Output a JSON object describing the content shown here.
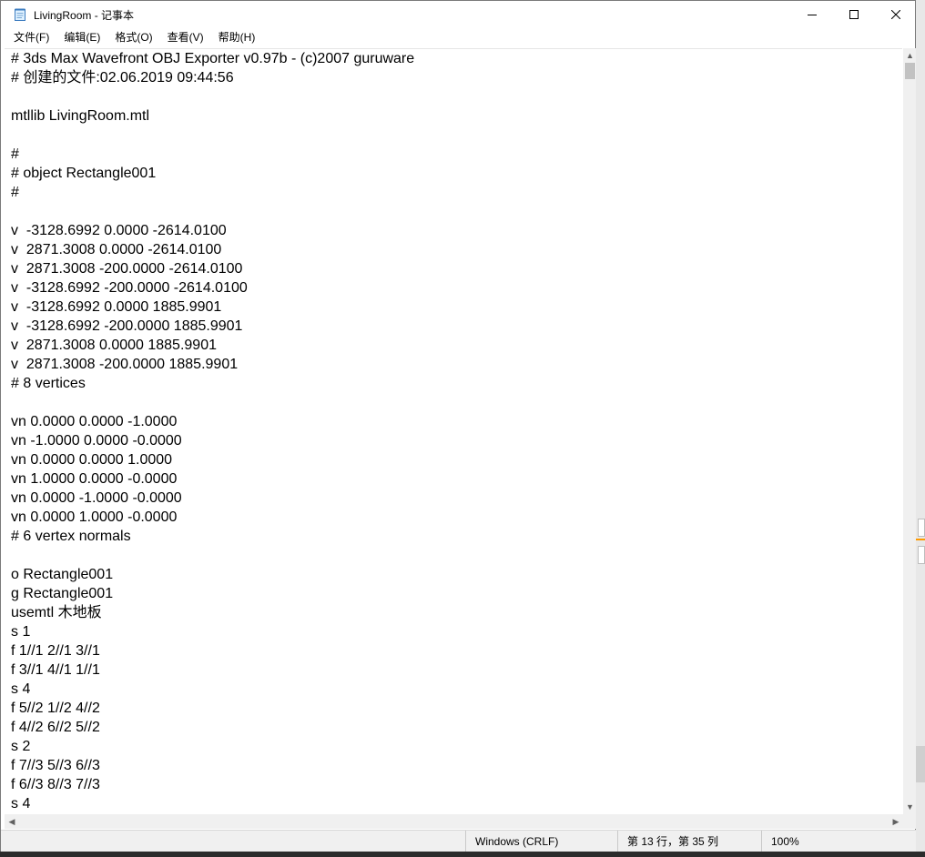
{
  "window": {
    "title": "LivingRoom - 记事本",
    "icons": {
      "app": "notepad-icon",
      "minimize": "minimize-icon",
      "maximize": "maximize-icon",
      "close": "close-icon"
    }
  },
  "menu": {
    "items": [
      "文件(F)",
      "编辑(E)",
      "格式(O)",
      "查看(V)",
      "帮助(H)"
    ]
  },
  "editor": {
    "lines": [
      "# 3ds Max Wavefront OBJ Exporter v0.97b - (c)2007 guruware",
      "# 创建的文件:02.06.2019 09:44:56",
      "",
      "mtllib LivingRoom.mtl",
      "",
      "#",
      "# object Rectangle001",
      "#",
      "",
      "v  -3128.6992 0.0000 -2614.0100",
      "v  2871.3008 0.0000 -2614.0100",
      "v  2871.3008 -200.0000 -2614.0100",
      "v  -3128.6992 -200.0000 -2614.0100",
      "v  -3128.6992 0.0000 1885.9901",
      "v  -3128.6992 -200.0000 1885.9901",
      "v  2871.3008 0.0000 1885.9901",
      "v  2871.3008 -200.0000 1885.9901",
      "# 8 vertices",
      "",
      "vn 0.0000 0.0000 -1.0000",
      "vn -1.0000 0.0000 -0.0000",
      "vn 0.0000 0.0000 1.0000",
      "vn 1.0000 0.0000 -0.0000",
      "vn 0.0000 -1.0000 -0.0000",
      "vn 0.0000 1.0000 -0.0000",
      "# 6 vertex normals",
      "",
      "o Rectangle001",
      "g Rectangle001",
      "usemtl 木地板",
      "s 1",
      "f 1//1 2//1 3//1",
      "f 3//1 4//1 1//1",
      "s 4",
      "f 5//2 1//2 4//2",
      "f 4//2 6//2 5//2",
      "s 2",
      "f 7//3 5//3 6//3",
      "f 6//3 8//3 7//3",
      "s 4"
    ]
  },
  "status": {
    "encoding": "Windows (CRLF)",
    "position": "第 13 行，第 35 列",
    "zoom": "100%"
  }
}
